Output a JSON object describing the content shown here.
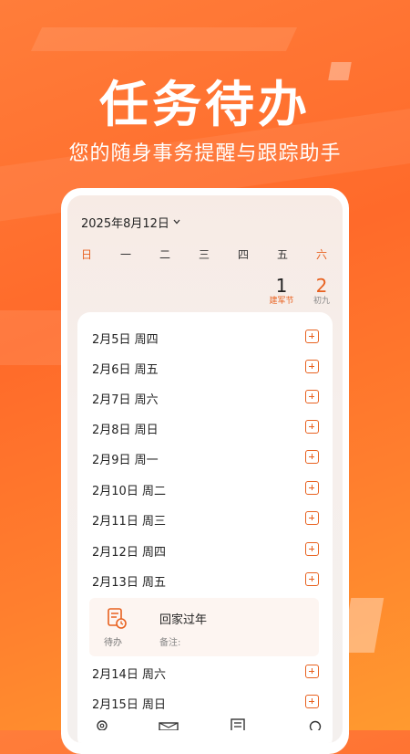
{
  "hero": {
    "title": "任务待办",
    "subtitle": "您的随身事务提醒与跟踪助手"
  },
  "calendar": {
    "current_date": "2025年8月12日",
    "weekdays": [
      "日",
      "一",
      "二",
      "三",
      "四",
      "五",
      "六"
    ],
    "visible_days": [
      {
        "num": "1",
        "sub": "建军节"
      },
      {
        "num": "2",
        "sub": "初九"
      }
    ]
  },
  "list": {
    "rows": [
      {
        "label": "2月5日 周四"
      },
      {
        "label": "2月6日 周五"
      },
      {
        "label": "2月7日 周六"
      },
      {
        "label": "2月8日 周日"
      },
      {
        "label": "2月9日 周一"
      },
      {
        "label": "2月10日 周二"
      },
      {
        "label": "2月11日 周三"
      },
      {
        "label": "2月12日 周四"
      },
      {
        "label": "2月13日 周五"
      },
      {
        "label": "2月14日 周六"
      },
      {
        "label": "2月15日 周日"
      }
    ],
    "task": {
      "type": "待办",
      "title": "回家过年",
      "note": "备注:"
    }
  },
  "colors": {
    "accent": "#e8611f",
    "background": "#ff6a2a"
  },
  "icons": [
    "chevron-down-icon",
    "add-icon",
    "todo-icon",
    "settings-icon",
    "mail-icon",
    "list-icon",
    "search-icon"
  ]
}
